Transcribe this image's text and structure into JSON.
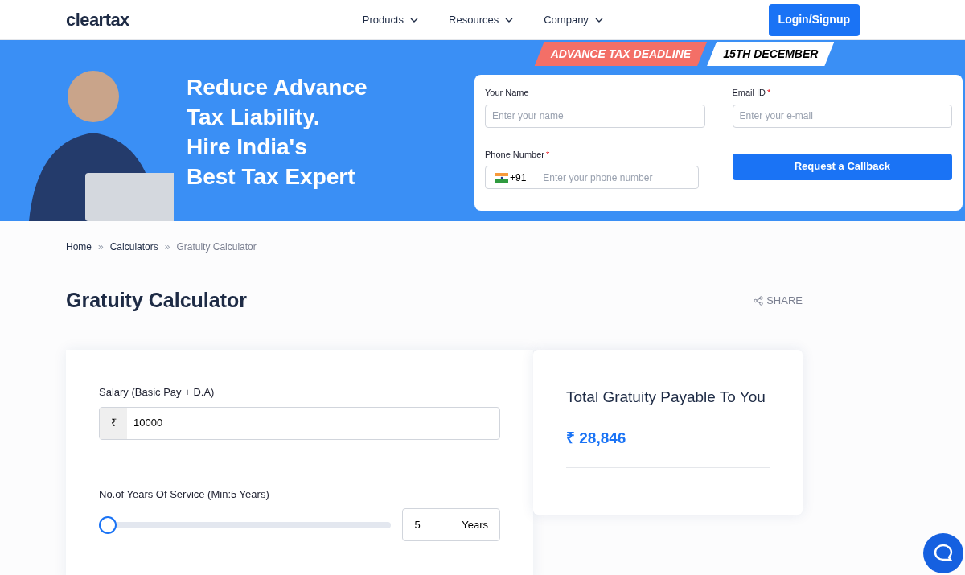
{
  "header": {
    "logo": "cleartax",
    "nav": [
      {
        "label": "Products"
      },
      {
        "label": "Resources"
      },
      {
        "label": "Company"
      }
    ],
    "login": "Login/Signup"
  },
  "banner": {
    "headline": [
      "Reduce Advance",
      "Tax Liability.",
      "Hire India's",
      "Best Tax Expert"
    ],
    "deadline_label": "ADVANCE TAX DEADLINE",
    "deadline_date": "15TH DECEMBER",
    "form": {
      "name": {
        "label": "Your Name",
        "placeholder": "Enter your name"
      },
      "email": {
        "label": "Email ID",
        "required_mark": "*",
        "placeholder": "Enter your e-mail"
      },
      "phone": {
        "label": "Phone Number",
        "required_mark": "*",
        "code": "+91",
        "placeholder": "Enter your phone number"
      },
      "submit": "Request a Callback"
    }
  },
  "breadcrumb": [
    {
      "label": "Home",
      "current": false
    },
    {
      "separator": "»",
      "label": "Calculators",
      "current": false
    },
    {
      "separator": "»",
      "label": "Gratuity Calculator",
      "current": true
    }
  ],
  "title": "Gratuity Calculator",
  "share": "SHARE",
  "calculator": {
    "salary": {
      "label": "Salary (Basic Pay + D.A)",
      "prefix": "₹",
      "value": "10000"
    },
    "years": {
      "label": "No.of Years Of Service (Min:5 Years)",
      "level": 0,
      "value": "5",
      "unit": "Years"
    }
  },
  "result": {
    "label": "Total Gratuity Payable To You",
    "amount": "₹ 28,846"
  }
}
